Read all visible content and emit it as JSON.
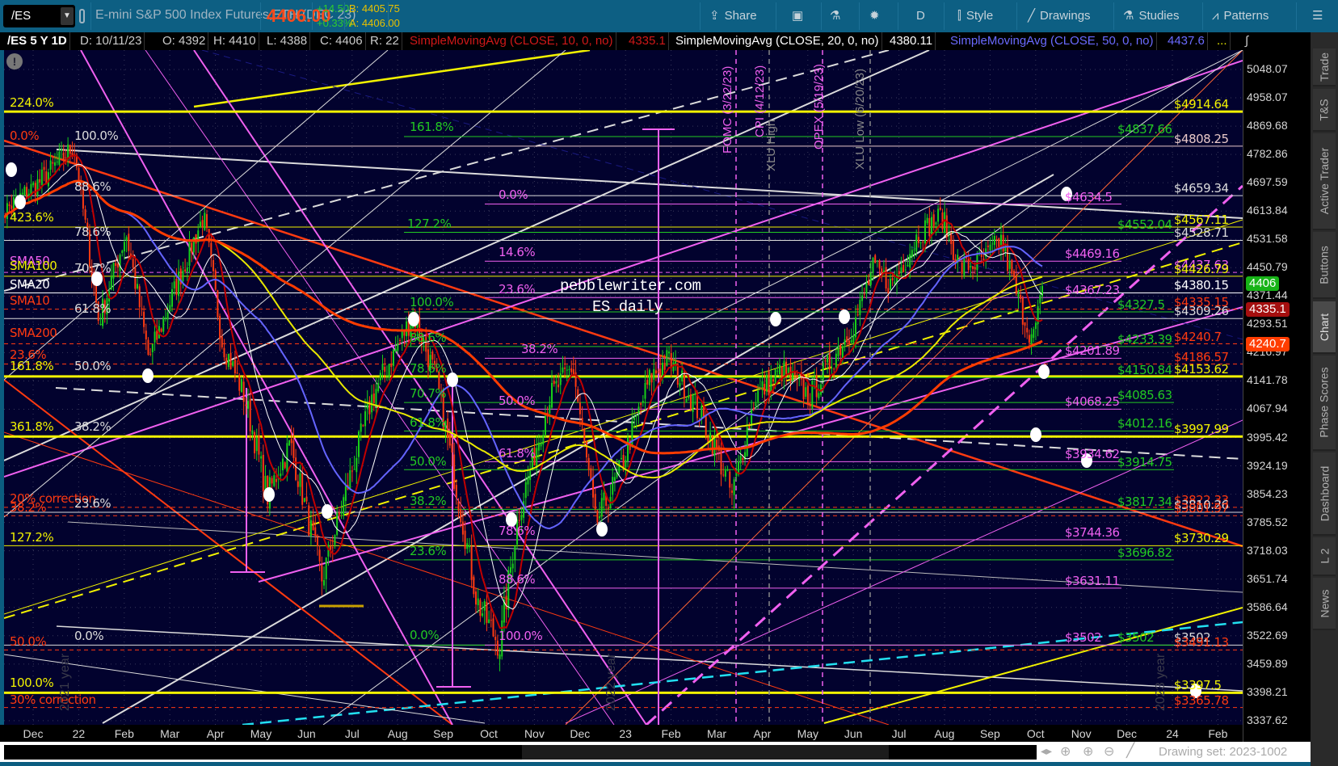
{
  "toolbar": {
    "symbol": "/ES",
    "description": "E-mini S&P 500 Index Futures,ETH (DEC 23)",
    "last": "4406.00",
    "change": "+14.50",
    "change_pct": "+0.33%",
    "bid": "B: 4405.75",
    "ask": "A: 4406.00",
    "share": "Share",
    "period": "D",
    "style": "Style",
    "drawings": "Drawings",
    "studies": "Studies",
    "patterns": "Patterns"
  },
  "infobar": {
    "title": "/ES 5 Y 1D",
    "date": "D: 10/11/23",
    "open": "O: 4392",
    "high": "H: 4410",
    "low": "L: 4388",
    "close": "C: 4406",
    "range": "R: 22",
    "sma10_label": "SimpleMovingAvg (CLOSE, 10, 0, no)",
    "sma10_value": "4335.1",
    "sma20_label": "SimpleMovingAvg (CLOSE, 20, 0, no)",
    "sma20_value": "4380.11",
    "sma50_label": "SimpleMovingAvg (CLOSE, 50, 0, no)",
    "sma50_value": "4437.6",
    "more": "..."
  },
  "colors": {
    "yellow": "#f2f200",
    "red": "#ff3a10",
    "white": "#dcdcdc",
    "green": "#22c922",
    "pink": "#f060f0",
    "blue": "#6464ff",
    "cyan": "#22e0f0"
  },
  "price_axis": {
    "ticks": [
      "5048.07",
      "4958.07",
      "4869.68",
      "4782.86",
      "4697.59",
      "4613.84",
      "4531.58",
      "4450.79",
      "4371.44",
      "4293.51",
      "4216.97",
      "4141.78",
      "4067.94",
      "3995.42",
      "3924.19",
      "3854.23",
      "3785.52",
      "3718.03",
      "3651.74",
      "3586.64",
      "3522.69",
      "3459.89",
      "3398.21",
      "3337.62"
    ],
    "range": [
      3337.62,
      5048.07
    ],
    "badges": [
      {
        "value": "4406",
        "price": 4406,
        "color": "#17b317"
      },
      {
        "value": "4335.1",
        "price": 4335.1,
        "color": "#a50f0f"
      },
      {
        "value": "4240.7",
        "price": 4240.7,
        "color": "#ff3d00"
      }
    ]
  },
  "time_axis": {
    "months": [
      "Dec",
      "22",
      "Feb",
      "Mar",
      "Apr",
      "May",
      "Jun",
      "Jul",
      "Aug",
      "Sep",
      "Oct",
      "Nov",
      "Dec",
      "23",
      "Feb",
      "Mar",
      "Apr",
      "May",
      "Jun",
      "Jul",
      "Aug",
      "Sep",
      "Oct",
      "Nov",
      "Dec",
      "24",
      "Feb"
    ]
  },
  "levels": {
    "right": [
      {
        "label": "$4914.64",
        "price": 4914.64,
        "color": "#f2f200"
      },
      {
        "label": "$4808.25",
        "price": 4808.25,
        "color": "#e8c8c8"
      },
      {
        "label": "$4659.34",
        "price": 4659.34,
        "color": "#dcdcdc"
      },
      {
        "label": "$4567.11",
        "price": 4567.11,
        "color": "#f2f200"
      },
      {
        "label": "$4528.71",
        "price": 4528.71,
        "color": "#dcdcdc"
      },
      {
        "label": "$4437.63",
        "price": 4437.63,
        "color": "#f060f0"
      },
      {
        "label": "$4426.79",
        "price": 4426.79,
        "color": "#f2f200"
      },
      {
        "label": "$4380.15",
        "price": 4380.15,
        "color": "#ffffff"
      },
      {
        "label": "$4335.15",
        "price": 4335.15,
        "color": "#ff3a10"
      },
      {
        "label": "$4309.26",
        "price": 4309.26,
        "color": "#dcdcdc"
      },
      {
        "label": "$4240.7",
        "price": 4240.7,
        "color": "#ff3a10"
      },
      {
        "label": "$4186.57",
        "price": 4186.57,
        "color": "#ff3a10"
      },
      {
        "label": "$4153.62",
        "price": 4153.62,
        "color": "#f2f200"
      },
      {
        "label": "$3997.99",
        "price": 3997.99,
        "color": "#f2f200"
      },
      {
        "label": "$3822.33",
        "price": 3822.33,
        "color": "#ff3a10"
      },
      {
        "label": "$3810.26",
        "price": 3810.26,
        "color": "#dcdcdc"
      },
      {
        "label": "$3801.97",
        "price": 3801.97,
        "color": "#ff3a10"
      },
      {
        "label": "$3730.29",
        "price": 3730.29,
        "color": "#f2f200"
      },
      {
        "label": "$3502",
        "price": 3502,
        "color": "#dcdcdc"
      },
      {
        "label": "$3491.13",
        "price": 3491.13,
        "color": "#ff3a10"
      },
      {
        "label": "$3397.5",
        "price": 3397.5,
        "color": "#f2f200"
      },
      {
        "label": "$3365.78",
        "price": 3365.78,
        "color": "#ff3a10"
      }
    ],
    "green": [
      {
        "label": "$4837.66",
        "price": 4837.66,
        "color": "#22c922"
      },
      {
        "label": "$4552.04",
        "price": 4552.04,
        "color": "#22c922"
      },
      {
        "label": "$4327.5",
        "price": 4327.5,
        "color": "#22c922"
      },
      {
        "label": "$4233.39",
        "price": 4233.39,
        "color": "#22c922"
      },
      {
        "label": "$4150.84",
        "price": 4150.84,
        "color": "#22c922"
      },
      {
        "label": "$4085.63",
        "price": 4085.63,
        "color": "#22c922"
      },
      {
        "label": "$4012.16",
        "price": 4012.16,
        "color": "#22c922"
      },
      {
        "label": "$3914.75",
        "price": 3914.75,
        "color": "#22c922"
      },
      {
        "label": "$3817.34",
        "price": 3817.34,
        "color": "#22c922"
      },
      {
        "label": "$3696.82",
        "price": 3696.82,
        "color": "#22c922"
      },
      {
        "label": "$3502",
        "price": 3502,
        "color": "#22c922"
      }
    ],
    "pink": [
      {
        "label": "$4634.5",
        "price": 4634.5,
        "color": "#f060f0"
      },
      {
        "label": "$4469.16",
        "price": 4469.16,
        "color": "#f060f0"
      },
      {
        "label": "$4367.23",
        "price": 4367.23,
        "color": "#f060f0"
      },
      {
        "label": "$4201.89",
        "price": 4201.89,
        "color": "#f060f0"
      },
      {
        "label": "$4068.25",
        "price": 4068.25,
        "color": "#f060f0"
      },
      {
        "label": "$3934.62",
        "price": 3934.62,
        "color": "#f060f0"
      },
      {
        "label": "$3744.36",
        "price": 3744.36,
        "color": "#f060f0"
      },
      {
        "label": "$3631.11",
        "price": 3631.11,
        "color": "#f060f0"
      },
      {
        "label": "$3502",
        "price": 3502,
        "color": "#f060f0"
      }
    ]
  },
  "fib_labels": {
    "left": [
      {
        "text": "224.0%",
        "color": "#f2f200"
      },
      {
        "text": "0.0%",
        "color": "#ff3a10"
      },
      {
        "text": "423.6%",
        "color": "#f2f200"
      },
      {
        "text": "SMA50",
        "color": "#f060f0"
      },
      {
        "text": "SMA100",
        "color": "#f2f200"
      },
      {
        "text": "SMA20",
        "color": "#ffffff"
      },
      {
        "text": "SMA10",
        "color": "#ff3a10"
      },
      {
        "text": "SMA200",
        "color": "#ff3a10"
      },
      {
        "text": "23.6%",
        "color": "#ff3a10"
      },
      {
        "text": "161.8%",
        "color": "#f2f200"
      },
      {
        "text": "361.8%",
        "color": "#f2f200"
      },
      {
        "text": "20% correction",
        "color": "#ff3a10"
      },
      {
        "text": "38.2%",
        "color": "#ff3a10"
      },
      {
        "text": "127.2%",
        "color": "#f2f200"
      },
      {
        "text": "50.0%",
        "color": "#ff3a10"
      },
      {
        "text": "100.0%",
        "color": "#f2f200"
      },
      {
        "text": "30% correction",
        "color": "#ff3a10"
      }
    ],
    "left2": [
      {
        "text": "100.0%",
        "color": "#dcdcdc"
      },
      {
        "text": "88.6%",
        "color": "#dcdcdc"
      },
      {
        "text": "78.6%",
        "color": "#dcdcdc"
      },
      {
        "text": "70.7%",
        "color": "#dcdcdc"
      },
      {
        "text": "61.8%",
        "color": "#dcdcdc"
      },
      {
        "text": "50.0%",
        "color": "#dcdcdc"
      },
      {
        "text": "38.2%",
        "color": "#dcdcdc"
      },
      {
        "text": "23.6%",
        "color": "#dcdcdc"
      },
      {
        "text": "0.0%",
        "color": "#dcdcdc"
      }
    ],
    "green": [
      {
        "text": "161.8%",
        "color": "#22c922"
      },
      {
        "text": "127.2%",
        "color": "#22c922"
      },
      {
        "text": "100.0%",
        "color": "#22c922"
      },
      {
        "text": "88.6%",
        "color": "#22c922"
      },
      {
        "text": "78.6%",
        "color": "#22c922"
      },
      {
        "text": "70.7%",
        "color": "#22c922"
      },
      {
        "text": "61.8%",
        "color": "#22c922"
      },
      {
        "text": "50.0%",
        "color": "#22c922"
      },
      {
        "text": "38.2%",
        "color": "#22c922"
      },
      {
        "text": "23.6%",
        "color": "#22c922"
      },
      {
        "text": "0.0%",
        "color": "#22c922"
      }
    ],
    "pink": [
      {
        "text": "0.0%",
        "color": "#f060f0"
      },
      {
        "text": "14.6%",
        "color": "#f060f0"
      },
      {
        "text": "23.6%",
        "color": "#f060f0"
      },
      {
        "text": "38.2%",
        "color": "#f060f0"
      },
      {
        "text": "50.0%",
        "color": "#f060f0"
      },
      {
        "text": "61.8%",
        "color": "#f060f0"
      },
      {
        "text": "78.6%",
        "color": "#f060f0"
      },
      {
        "text": "88.6%",
        "color": "#f060f0"
      },
      {
        "text": "100.0%",
        "color": "#f060f0"
      }
    ]
  },
  "annotations": {
    "watermark": "pebblewriter.com",
    "subtitle": "ES daily",
    "events": [
      {
        "text": "FOMC (3/22/23)",
        "color": "#f060f0"
      },
      {
        "text": "CPI (4/12/23)",
        "color": "#f060f0"
      },
      {
        "text": "XLU High",
        "color": "#888888"
      },
      {
        "text": "OPEX (5/19/23)",
        "color": "#f060f0"
      },
      {
        "text": "XLU Low (6/20/23)",
        "color": "#888888"
      }
    ],
    "years": [
      "2021 year",
      "2022 year",
      "2023 year"
    ]
  },
  "price_path": [
    [
      -0.6,
      4600
    ],
    [
      0.3,
      4700
    ],
    [
      1.05,
      4808
    ],
    [
      1.6,
      4300
    ],
    [
      2.2,
      4550
    ],
    [
      2.7,
      4200
    ],
    [
      3.3,
      4400
    ],
    [
      3.9,
      4600
    ],
    [
      4.3,
      4250
    ],
    [
      4.8,
      4100
    ],
    [
      5.3,
      3850
    ],
    [
      5.8,
      3980
    ],
    [
      6.5,
      3650
    ],
    [
      7.0,
      3850
    ],
    [
      7.6,
      4100
    ],
    [
      8.5,
      4320
    ],
    [
      9.0,
      4150
    ],
    [
      9.4,
      3900
    ],
    [
      9.9,
      3600
    ],
    [
      10.4,
      3500
    ],
    [
      10.8,
      3800
    ],
    [
      11.5,
      4100
    ],
    [
      12.0,
      4180
    ],
    [
      12.5,
      3780
    ],
    [
      13.0,
      3900
    ],
    [
      13.7,
      4150
    ],
    [
      14.1,
      4200
    ],
    [
      14.6,
      4100
    ],
    [
      15.1,
      3980
    ],
    [
      15.5,
      3850
    ],
    [
      16.0,
      4100
    ],
    [
      16.6,
      4170
    ],
    [
      17.2,
      4100
    ],
    [
      17.7,
      4200
    ],
    [
      18.2,
      4300
    ],
    [
      18.6,
      4450
    ],
    [
      19.0,
      4400
    ],
    [
      19.6,
      4550
    ],
    [
      20.1,
      4600
    ],
    [
      20.5,
      4450
    ],
    [
      21.0,
      4470
    ],
    [
      21.4,
      4530
    ],
    [
      21.8,
      4350
    ],
    [
      22.1,
      4250
    ],
    [
      22.35,
      4406
    ]
  ],
  "sidebar_tabs": [
    {
      "label": "Trade",
      "active": false
    },
    {
      "label": "T&S",
      "active": false
    },
    {
      "label": "Active Trader",
      "active": false
    },
    {
      "label": "Buttons",
      "active": false
    },
    {
      "label": "Chart",
      "active": true
    },
    {
      "label": "Phase Scores",
      "active": false
    },
    {
      "label": "Dashboard",
      "active": false
    },
    {
      "label": "L 2",
      "active": false
    },
    {
      "label": "News",
      "active": false
    }
  ],
  "bottom": {
    "drawing_set": "Drawing set: 2023-1002"
  }
}
